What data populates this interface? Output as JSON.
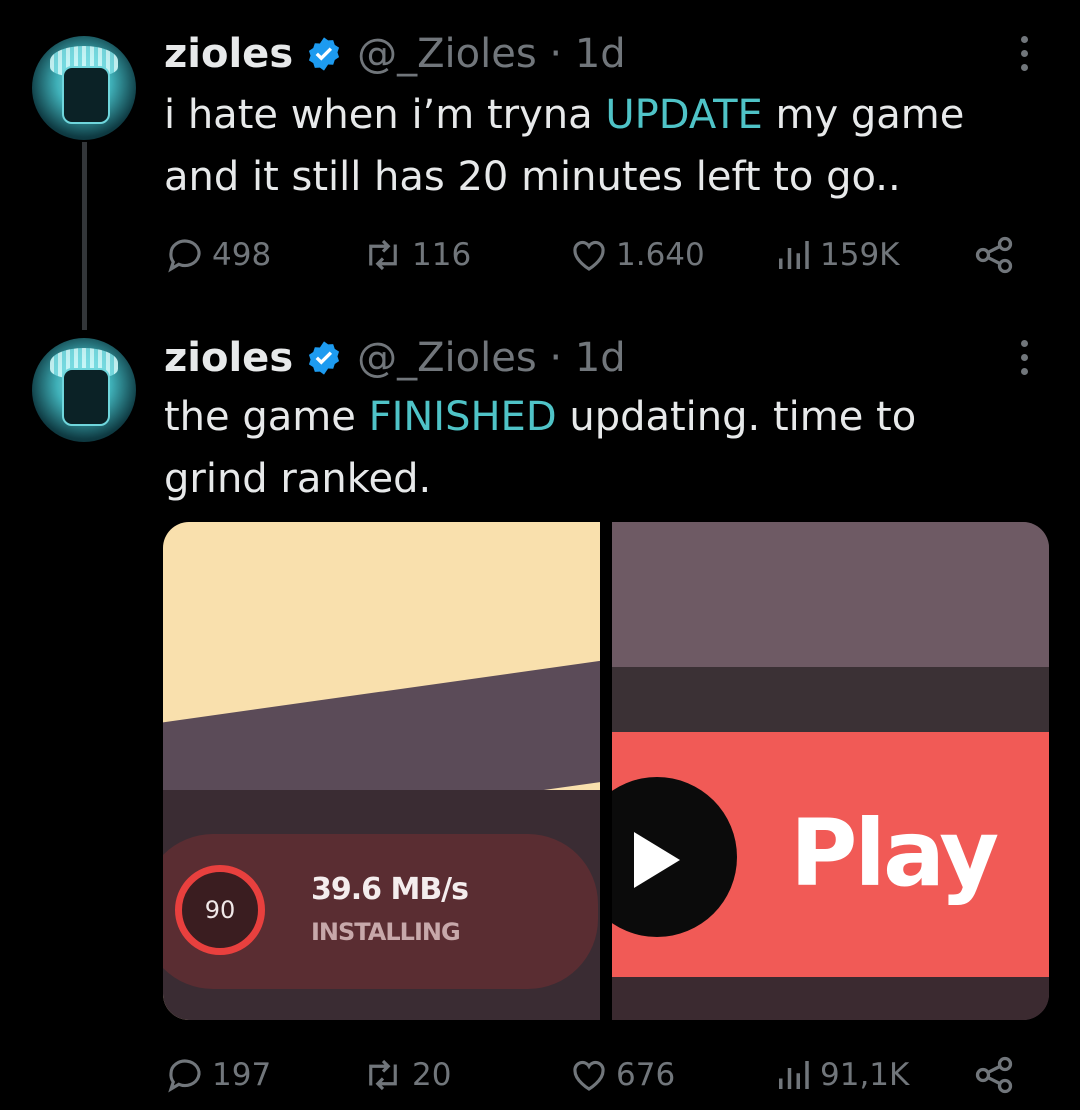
{
  "tweets": [
    {
      "name": "zioles",
      "handle": "@_Zioles · 1d",
      "text_before": "i hate when i’m tryna ",
      "text_highlight": "UPDATE",
      "text_after": " my game and it still has 20 minutes left to go..",
      "replies": "498",
      "reposts": "116",
      "likes": "1.640",
      "views": "159K"
    },
    {
      "name": "zioles",
      "handle": "@_Zioles · 1d",
      "text_before": "the game ",
      "text_highlight": "FINISHED",
      "text_after": " updating. time to grind ranked.",
      "replies": "197",
      "reposts": "20",
      "likes": "676",
      "views": "91,1K",
      "media": {
        "left": {
          "progress_value": "90",
          "speed": "39.6 MB/s",
          "status": "INSTALLING"
        },
        "right": {
          "button_label": "Play"
        }
      }
    }
  ],
  "colors": {
    "highlight": "#4fc3c7",
    "verified": "#1d9bf0",
    "muted": "#71767b",
    "play_red": "#f15a56"
  },
  "icons": [
    "verified-badge-icon",
    "more-icon",
    "reply-icon",
    "repost-icon",
    "like-icon",
    "views-icon",
    "share-icon",
    "play-icon",
    "progress-ring-icon"
  ]
}
